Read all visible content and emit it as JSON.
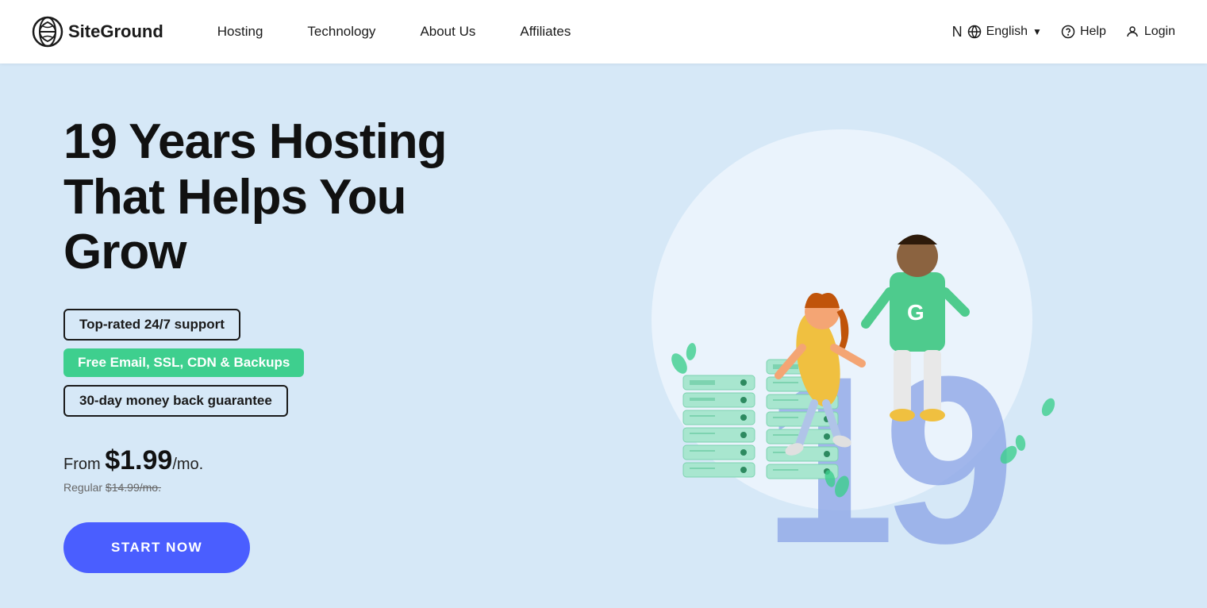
{
  "nav": {
    "logo_text": "SiteGround",
    "links": [
      {
        "label": "Hosting",
        "href": "#"
      },
      {
        "label": "Technology",
        "href": "#"
      },
      {
        "label": "About Us",
        "href": "#"
      },
      {
        "label": "Affiliates",
        "href": "#"
      }
    ],
    "language": "English",
    "help": "Help",
    "login": "Login"
  },
  "hero": {
    "title_line1": "19 Years Hosting",
    "title_line2": "That Helps You Grow",
    "badges": [
      {
        "text": "Top-rated 24/7 support",
        "type": "outline"
      },
      {
        "text": "Free Email, SSL, CDN & Backups",
        "type": "green"
      },
      {
        "text": "30-day money back guarantee",
        "type": "outline"
      }
    ],
    "from_label": "From",
    "price": "$1.99",
    "per_mo": "/mo.",
    "regular_label": "Regular",
    "regular_price": "$14.99/mo.",
    "cta_button": "START NOW"
  }
}
